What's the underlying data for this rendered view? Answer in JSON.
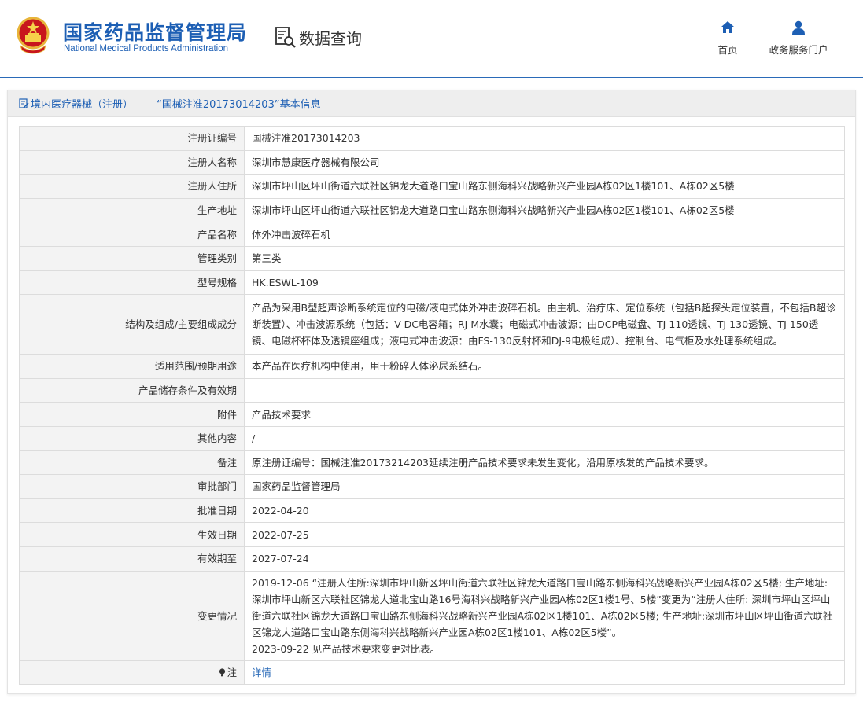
{
  "header": {
    "title_cn": "国家药品监督管理局",
    "title_en": "National Medical Products Administration",
    "emblem_icon": "national-emblem-icon",
    "data_query": "数据查询",
    "nav": [
      {
        "label": "首页",
        "icon": "home-icon"
      },
      {
        "label": "政务服务门户",
        "icon": "user-icon"
      }
    ],
    "brand_color": "#1d5fb4"
  },
  "panel": {
    "title": "境内医疗器械（注册） ——“国械注准20173014203”基本信息"
  },
  "rows": [
    {
      "label": "注册证编号",
      "value": "国械注准20173014203"
    },
    {
      "label": "注册人名称",
      "value": "深圳市慧康医疗器械有限公司"
    },
    {
      "label": "注册人住所",
      "value": "深圳市坪山区坪山街道六联社区锦龙大道路口宝山路东侧海科兴战略新兴产业园A栋02区1楼101、A栋02区5楼"
    },
    {
      "label": "生产地址",
      "value": "深圳市坪山区坪山街道六联社区锦龙大道路口宝山路东侧海科兴战略新兴产业园A栋02区1楼101、A栋02区5楼"
    },
    {
      "label": "产品名称",
      "value": "体外冲击波碎石机"
    },
    {
      "label": "管理类别",
      "value": "第三类"
    },
    {
      "label": "型号规格",
      "value": "HK.ESWL-109"
    },
    {
      "label": "结构及组成/主要组成成分",
      "value": "产品为采用B型超声诊断系统定位的电磁/液电式体外冲击波碎石机。由主机、治疗床、定位系统（包括B超探头定位装置，不包括B超诊断装置）、冲击波源系统（包括：V-DC电容箱；RJ-M水囊；电磁式冲击波源：由DCP电磁盘、TJ-110透镜、TJ-130透镜、TJ-150透镜、电磁杯杯体及透镜座组成；液电式冲击波源：由FS-130反射杯和DJ-9电极组成）、控制台、电气柜及水处理系统组成。"
    },
    {
      "label": "适用范围/预期用途",
      "value": "本产品在医疗机构中使用，用于粉碎人体泌尿系结石。"
    },
    {
      "label": "产品储存条件及有效期",
      "value": ""
    },
    {
      "label": "附件",
      "value": "产品技术要求"
    },
    {
      "label": "其他内容",
      "value": "/"
    },
    {
      "label": "备注",
      "value": "原注册证编号：国械注准20173214203延续注册产品技术要求未发生变化，沿用原核发的产品技术要求。"
    },
    {
      "label": "审批部门",
      "value": "国家药品监督管理局"
    },
    {
      "label": "批准日期",
      "value": "2022-04-20"
    },
    {
      "label": "生效日期",
      "value": "2022-07-25"
    },
    {
      "label": "有效期至",
      "value": "2027-07-24"
    }
  ],
  "change": {
    "label": "变更情况",
    "line1": "2019-12-06 “注册人住所:深圳市坪山新区坪山街道六联社区锦龙大道路口宝山路东侧海科兴战略新兴产业园A栋02区5楼; 生产地址:深圳市坪山新区六联社区锦龙大道北宝山路16号海科兴战略新兴产业园A栋02区1楼1号、5楼”变更为“注册人住所: 深圳市坪山区坪山街道六联社区锦龙大道路口宝山路东侧海科兴战略新兴产业园A栋02区1楼101、A栋02区5楼; 生产地址:深圳市坪山区坪山街道六联社区锦龙大道路口宝山路东侧海科兴战略新兴产业园A栋02区1楼101、A栋02区5楼”。",
    "line2": "2023-09-22 见产品技术要求变更对比表。"
  },
  "note": {
    "label": "注",
    "icon": "lightbulb-icon",
    "link": "详情"
  }
}
